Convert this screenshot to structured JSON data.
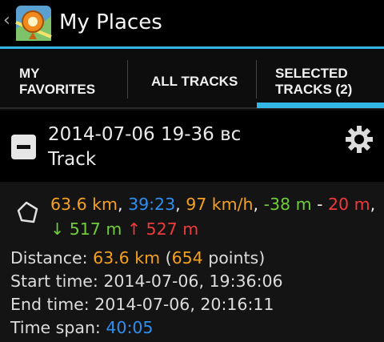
{
  "actionbar": {
    "title": "My Places",
    "back_icon": "chevron-left-icon",
    "app_icon": "osmand-map-pin-icon"
  },
  "tabs": [
    {
      "line1": "MY",
      "line2": "FAVORITES",
      "selected": false
    },
    {
      "line1": "ALL TRACKS",
      "line2": "",
      "selected": false
    },
    {
      "line1": "SELECTED",
      "line2": "TRACKS (2)",
      "selected": true
    }
  ],
  "group": {
    "title_line1": "2014-07-06 19-36 вс",
    "title_line2": "Track",
    "collapse_icon": "minus-square-icon",
    "settings_icon": "gear-icon"
  },
  "track": {
    "icon": "polygon-track-icon",
    "summary": {
      "distance": "63.6 km",
      "sep1": ", ",
      "time": "39:23",
      "sep2": ", ",
      "speed": "97 km/h",
      "sep3": ", ",
      "ele_min": "-38 m",
      "dash": " - ",
      "ele_max": "20 m",
      "sep4": ", ",
      "down_arrow": "↓",
      "descent": " 517 m",
      "up_arrow": " ↑",
      "ascent": " 527 m"
    },
    "details": {
      "distance_label": "Distance: ",
      "distance_value": "63.6 km",
      "points_open": " (",
      "points_value": "654",
      "points_close": " points)",
      "start_label": "Start time: ",
      "start_value": "2014-07-06, 19:36:06",
      "end_label": "End time: ",
      "end_value": "2014-07-06, 20:16:11",
      "span_label": "Time span: ",
      "span_value": "40:05"
    }
  },
  "colors": {
    "accent": "#33b5e5",
    "orange": "#f4a020",
    "blue": "#2e8ff0",
    "green": "#6fcc3a",
    "red": "#ee3a3a"
  }
}
